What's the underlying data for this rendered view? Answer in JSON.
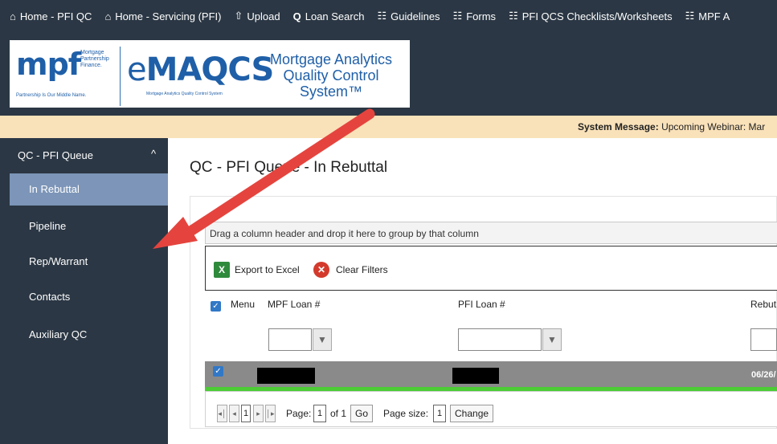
{
  "topnav": [
    {
      "label": "Home - PFI QC",
      "icon": "home-icon",
      "glyph": "⌂"
    },
    {
      "label": "Home - Servicing (PFI)",
      "icon": "home-icon",
      "glyph": "⌂"
    },
    {
      "label": "Upload",
      "icon": "upload-icon",
      "glyph": "⇧"
    },
    {
      "label": "Loan Search",
      "icon": "search-icon",
      "glyph": "Q"
    },
    {
      "label": "Guidelines",
      "icon": "document-icon",
      "glyph": "☷"
    },
    {
      "label": "Forms",
      "icon": "document-icon",
      "glyph": "☷"
    },
    {
      "label": "PFI QCS Checklists/Worksheets",
      "icon": "document-icon",
      "glyph": "☷"
    },
    {
      "label": "MPF A",
      "icon": "document-icon",
      "glyph": "☷"
    }
  ],
  "logo": {
    "mpf": "mpf",
    "mpf_small": "Mortgage Partnership Finance.",
    "mpf_tagline": "Partnership Is Our Middle Name.",
    "emaqcs_e": "e",
    "emaqcs_main": "MAQCS",
    "emaqcs_sub": "Mortgage Analytics Quality Control System",
    "title": "Mortgage Analytics Quality Control System™"
  },
  "system_message": {
    "label": "System Message:",
    "text": "Upcoming Webinar: Mar"
  },
  "sidebar": {
    "section": "QC - PFI Queue",
    "chevron": "^",
    "items": [
      {
        "label": "In Rebuttal",
        "active": true
      },
      {
        "label": "Pipeline",
        "active": false
      },
      {
        "label": "Rep/Warrant",
        "active": false
      },
      {
        "label": "Contacts",
        "active": false
      },
      {
        "label": "Auxiliary QC",
        "active": false
      }
    ]
  },
  "main": {
    "title": "QC - PFI Queue - In Rebuttal",
    "group_hint": "Drag a column header and drop it here to group by that column",
    "toolbar": {
      "export": "Export to Excel",
      "clear": "Clear Filters",
      "excel_glyph": "X",
      "clear_glyph": "✕"
    },
    "columns": [
      "Menu",
      "MPF Loan #",
      "PFI Loan #",
      "Rebut"
    ],
    "filter_glyph": "▼",
    "rows": [
      {
        "date": "06/26/"
      }
    ],
    "pager": {
      "first": "◂│",
      "prev": "◂",
      "current": "1",
      "next": "▸",
      "last": "│▸",
      "page_label": "Page:",
      "page_value": "1",
      "of_label": "of 1",
      "go": "Go",
      "size_label": "Page size:",
      "size_value": "1",
      "change": "Change"
    }
  },
  "colors": {
    "nav_bg": "#2b3744",
    "sidebar_active": "#7c95b8",
    "message_bar": "#f9e1b9",
    "row_highlight": "#8a8a8a",
    "row_accent": "#4ccc35",
    "arrow": "#e5443e",
    "logo_blue": "#1f5fa8"
  }
}
